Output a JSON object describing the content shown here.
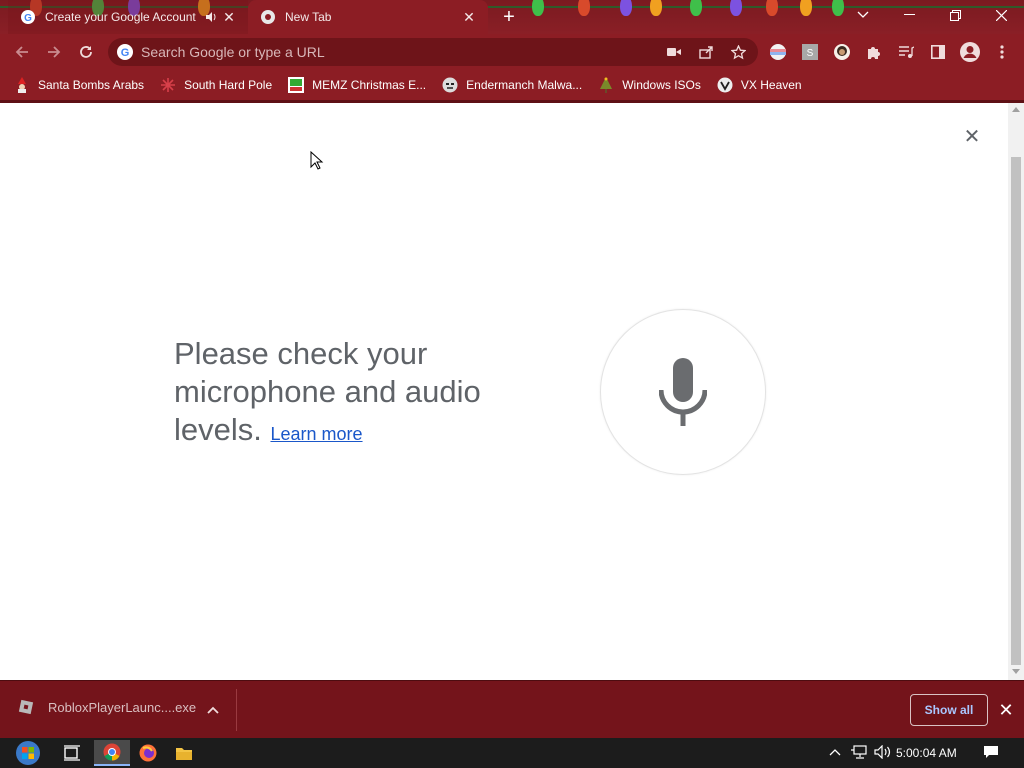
{
  "browser": {
    "tabs": [
      {
        "title": "Create your Google Account",
        "active": false,
        "audio": true
      },
      {
        "title": "New Tab",
        "active": true,
        "audio": false
      }
    ],
    "new_tab_icon": "plus-icon",
    "window_controls": [
      "chevron-down-icon",
      "minimize-icon",
      "restore-icon",
      "close-icon"
    ],
    "omnibox": {
      "placeholder": "Search Google or type a URL",
      "value": ""
    },
    "theme_color": "#8c1d24"
  },
  "bookmarks": [
    {
      "label": "Santa Bombs Arabs",
      "icon": "santa-icon"
    },
    {
      "label": "South Hard Pole",
      "icon": "snowflake-icon"
    },
    {
      "label": "MEMZ Christmas E...",
      "icon": "memz-icon"
    },
    {
      "label": "Endermanch Malwa...",
      "icon": "enderman-icon"
    },
    {
      "label": "Windows ISOs",
      "icon": "tree-icon"
    },
    {
      "label": "VX Heaven",
      "icon": "vx-heaven-icon"
    }
  ],
  "voice_search": {
    "message": "Please check your microphone and audio levels.",
    "learn_more": "Learn more"
  },
  "download_shelf": {
    "filename": "RobloxPlayerLaunc....exe",
    "show_all": "Show all"
  },
  "taskbar": {
    "clock": "5:00:04 AM"
  }
}
